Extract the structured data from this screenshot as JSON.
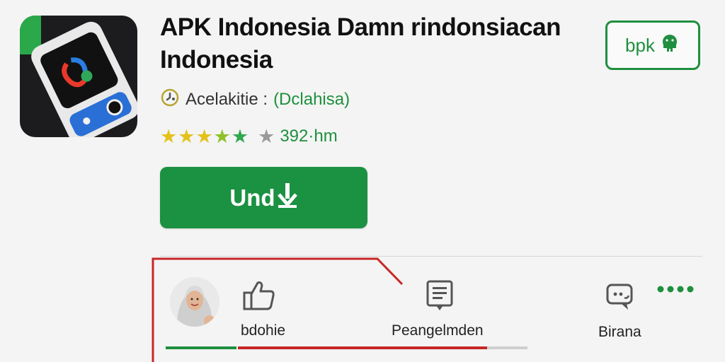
{
  "app": {
    "title": "APK Indonesia Damn rindonsiacan Indonesia",
    "top_button_label": "bpk",
    "developer_label": "Acelakitie :",
    "developer_name": "(Dclahisa)",
    "rating_stars": 5,
    "rating_count": "392·hm",
    "install_label": "Und"
  },
  "tabs": {
    "items": [
      {
        "label": "bdohie",
        "icon": "thumbs-up-icon"
      },
      {
        "label": "Peangelmden",
        "icon": "document-icon"
      },
      {
        "label": "Birana",
        "icon": "chat-icon"
      }
    ],
    "progress": 0.86
  },
  "colors": {
    "accent": "#1b9142",
    "star_gold": "#e4c21a",
    "star_green": "#2fa84f",
    "frame_red": "#c72727"
  }
}
